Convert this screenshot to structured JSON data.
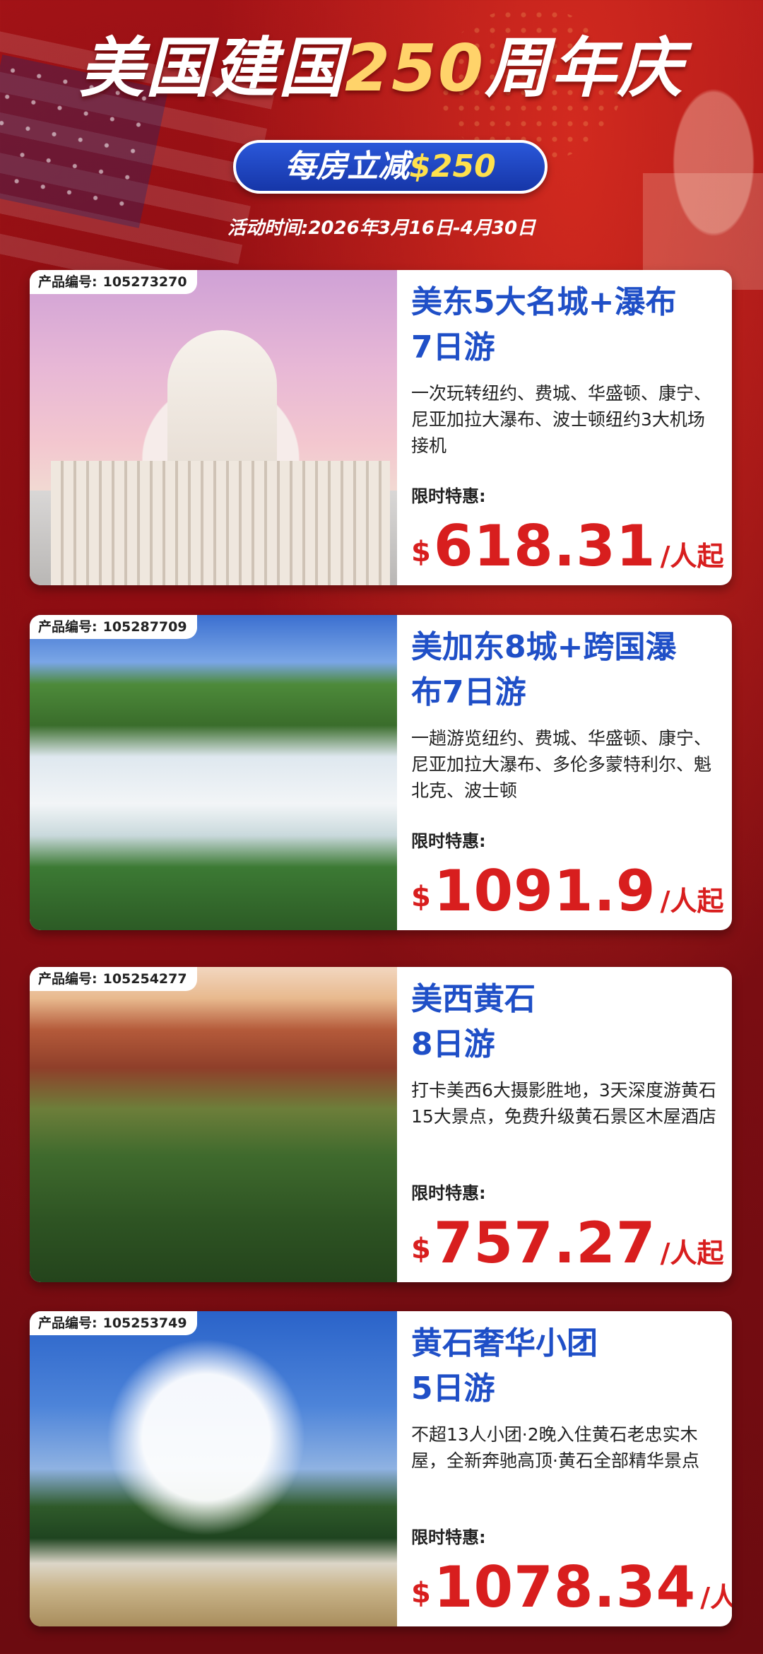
{
  "header": {
    "title_part1": "美国建国",
    "title_part2": "250",
    "title_part3": "周年庆",
    "discount_prefix": "每房立减",
    "discount_amount": "$250",
    "period": "活动时间:2026年3月16日-4月30日"
  },
  "labels": {
    "product_id": "产品编号:",
    "offer": "限时特惠:",
    "currency": "$",
    "unit": "/人起"
  },
  "products": [
    {
      "id": "105273270",
      "name_line1": "美东5大名城+瀑布",
      "name_line2": "7日游",
      "desc": "一次玩转纽约、费城、华盛顿、康宁、尼亚加拉大瀑布、波士顿纽约3大机场接机",
      "price": "618.31",
      "photo": "us-capitol"
    },
    {
      "id": "105287709",
      "name_line1": "美加东8城+跨国瀑",
      "name_line2": "布7日游",
      "desc": "一趟游览纽约、费城、华盛顿、康宁、尼亚加拉大瀑布、多伦多蒙特利尔、魁北克、波士顿",
      "price": "1091.9",
      "photo": "niagara-falls"
    },
    {
      "id": "105254277",
      "name_line1": "美西黄石",
      "name_line2": "8日游",
      "desc": "打卡美西6大摄影胜地，3天深度游黄石15大景点，免费升级黄石景区木屋酒店",
      "price": "757.27",
      "photo": "canyon-valley"
    },
    {
      "id": "105253749",
      "name_line1": "黄石奢华小团",
      "name_line2": "5日游",
      "desc": "不超13人小团·2晚入住黄石老忠实木屋，全新奔驰高顶·黄石全部精华景点",
      "price": "1078.34",
      "photo": "old-faithful-geyser"
    }
  ]
}
